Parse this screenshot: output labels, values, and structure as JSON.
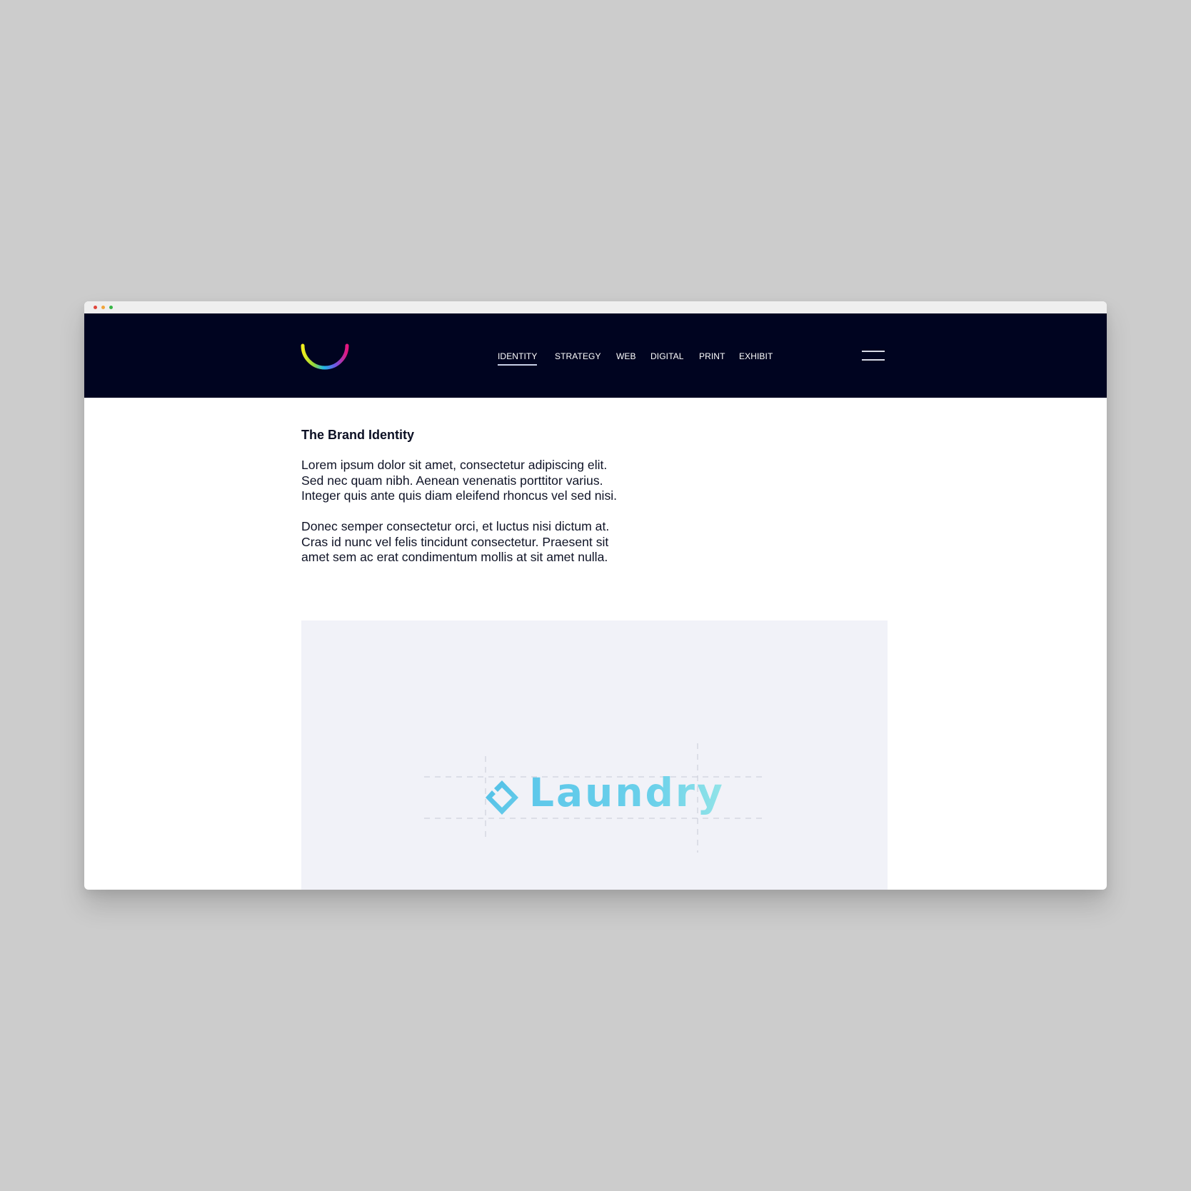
{
  "colors": {
    "page_background": "#cccccc",
    "window_background": "#ffffff",
    "titlebar_background": "#efefef",
    "header_background": "#000420",
    "showcase_background": "#f1f2f8",
    "text_primary": "#0f1326",
    "nav_text": "#ffffff",
    "nav_active_underline": "#c7cfe6",
    "laundry_blue": "#5ec8ea",
    "laundry_aqua": "#92e4e8",
    "dot_close": "#e0443a",
    "dot_minimize": "#f1a43a",
    "dot_maximize": "#36b545"
  },
  "window": {
    "titlebar_icons": [
      "close-dot-icon",
      "minimize-dot-icon",
      "maximize-dot-icon"
    ]
  },
  "header": {
    "logo_icon": "rainbow-smile-arc-icon",
    "menu_icon": "hamburger-menu-icon",
    "nav": {
      "active": "IDENTITY",
      "items": [
        {
          "label": "IDENTITY"
        },
        {
          "label": "STRATEGY"
        },
        {
          "label": "WEB"
        },
        {
          "label": "DIGITAL"
        },
        {
          "label": "PRINT"
        },
        {
          "label": "EXHIBIT"
        }
      ]
    }
  },
  "content": {
    "title": "The Brand Identity",
    "paragraphs": [
      {
        "lines": [
          "Lorem ipsum dolor sit amet, consectetur adipiscing elit.",
          "Sed nec quam nibh. Aenean venenatis porttitor varius.",
          "Integer quis ante quis diam eleifend rhoncus vel sed nisi."
        ]
      },
      {
        "lines": [
          "Donec semper consectetur orci, et luctus nisi dictum at.",
          "Cras id nunc vel felis tincidunt consectetur. Praesent sit",
          "amet sem ac erat condimentum mollis at sit amet nulla."
        ]
      }
    ]
  },
  "showcase": {
    "logo_mark_icon": "laundry-diamond-mark-icon",
    "wordmark": "Laundry"
  }
}
